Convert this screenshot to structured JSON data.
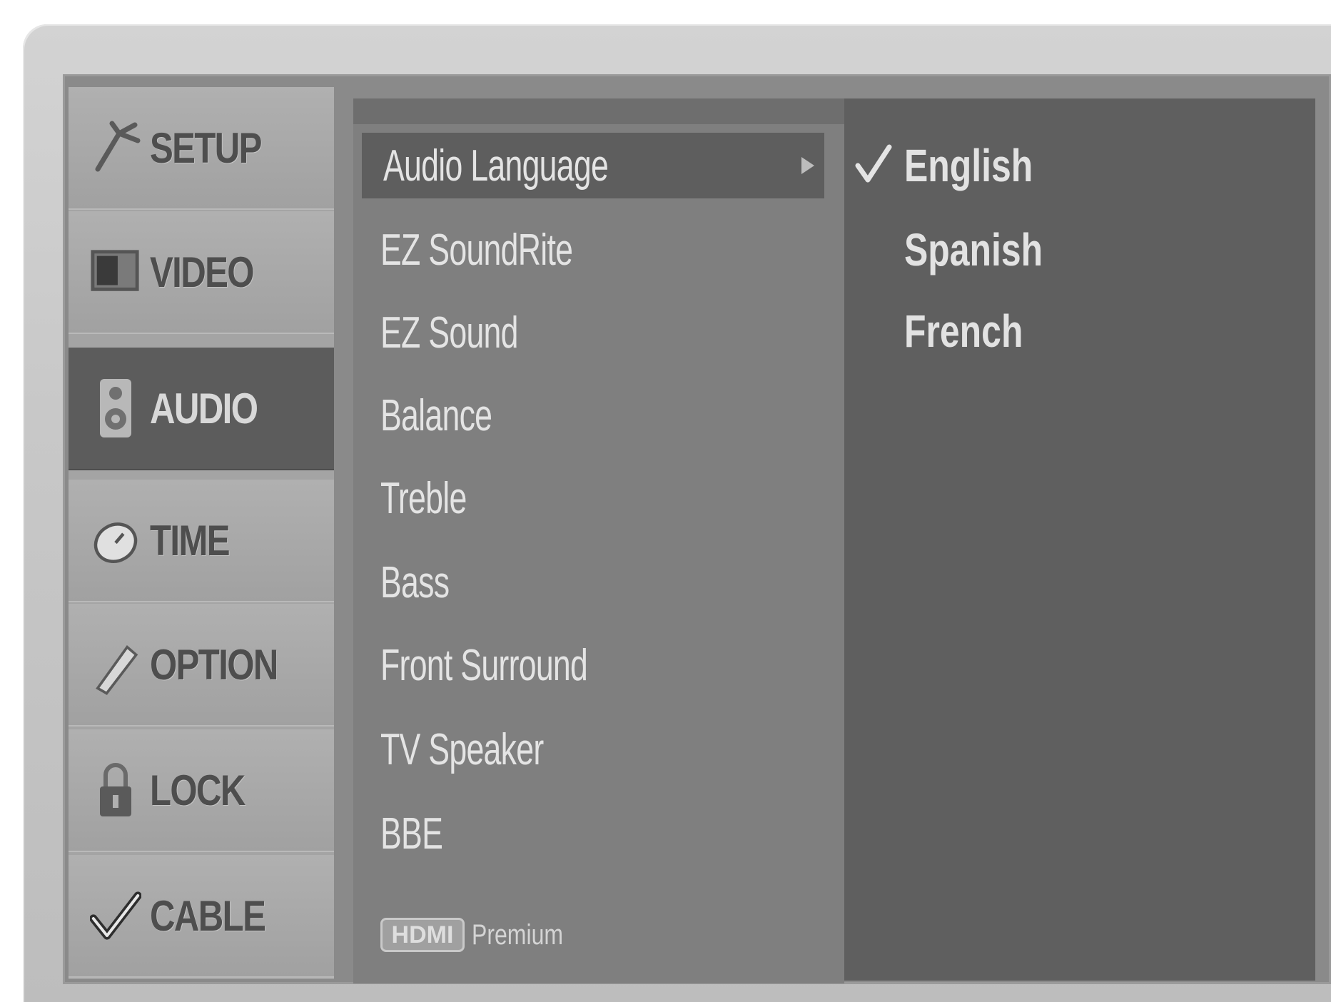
{
  "sidebar": {
    "items": [
      {
        "label": "SETUP",
        "icon": "setup-antenna-icon",
        "active": false
      },
      {
        "label": "VIDEO",
        "icon": "video-screen-icon",
        "active": false
      },
      {
        "label": "AUDIO",
        "icon": "audio-speaker-icon",
        "active": true
      },
      {
        "label": "TIME",
        "icon": "time-clock-icon",
        "active": false
      },
      {
        "label": "OPTION",
        "icon": "option-tool-icon",
        "active": false
      },
      {
        "label": "LOCK",
        "icon": "lock-padlock-icon",
        "active": false
      },
      {
        "label": "CABLE",
        "icon": "cable-checkmark-icon",
        "active": false
      }
    ]
  },
  "menu": {
    "items": [
      {
        "label": "Audio Language",
        "selected": true
      },
      {
        "label": "EZ SoundRite",
        "selected": false
      },
      {
        "label": "EZ Sound",
        "selected": false
      },
      {
        "label": "Balance",
        "selected": false
      },
      {
        "label": "Treble",
        "selected": false
      },
      {
        "label": "Bass",
        "selected": false
      },
      {
        "label": "Front Surround",
        "selected": false
      },
      {
        "label": "TV Speaker",
        "selected": false
      },
      {
        "label": "BBE",
        "selected": false
      }
    ],
    "badge": {
      "logo": "HDMI",
      "text": "Premium"
    }
  },
  "options": {
    "items": [
      {
        "label": "English",
        "checked": true
      },
      {
        "label": "Spanish",
        "checked": false
      },
      {
        "label": "French",
        "checked": false
      }
    ]
  },
  "colors": {
    "active_category": "#5c5c5c",
    "selected_item": "#5e5e5e",
    "options_panel": "#5f5f5f",
    "menu_panel": "#7f7f7f"
  }
}
